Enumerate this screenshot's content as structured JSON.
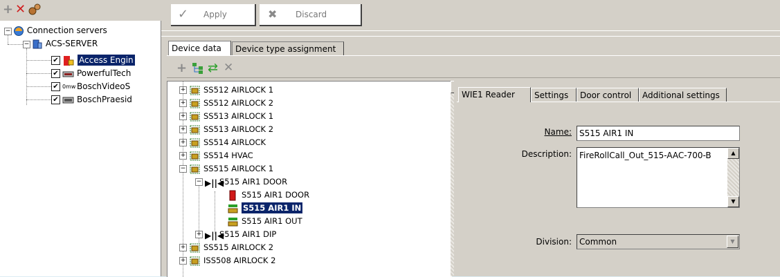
{
  "left_toolbar": {
    "icons": [
      "add-icon",
      "delete-icon",
      "connect-icon"
    ]
  },
  "left_tree": {
    "root_label": "Connection servers",
    "server_label": "ACS-SERVER",
    "items": [
      {
        "label": "Access Engin",
        "selected": true,
        "icon": "access-engine-icon"
      },
      {
        "label": "PowerfulTech",
        "selected": false,
        "icon": "device-icon"
      },
      {
        "label": "BoschVideoS",
        "selected": false,
        "icon": "video-icon"
      },
      {
        "label": "BoschPraesid",
        "selected": false,
        "icon": "device-icon"
      }
    ]
  },
  "toolbar": {
    "apply_label": "Apply",
    "discard_label": "Discard"
  },
  "tabs": {
    "device_data": "Device data",
    "device_type_assignment": "Device type assignment"
  },
  "device_toolbar": {
    "icons": [
      "add-icon",
      "tree-icon",
      "refresh-icon",
      "delete-icon"
    ]
  },
  "device_tree": {
    "rows": [
      {
        "label": "SS512 AIRLOCK 1"
      },
      {
        "label": "SS512 AIRLOCK 2"
      },
      {
        "label": "SS513 AIRLOCK 1"
      },
      {
        "label": "SS513 AIRLOCK 2"
      },
      {
        "label": "SS514 AIRLOCK"
      },
      {
        "label": "SS514 HVAC"
      },
      {
        "label": "SS515 AIRLOCK 1"
      },
      {
        "label": "S515 AIR1 DOOR"
      },
      {
        "label": "S515 AIR1 DOOR"
      },
      {
        "label": "S515 AIR1 IN"
      },
      {
        "label": "S515 AIR1 OUT"
      },
      {
        "label": "S515 AIR1 DIP"
      },
      {
        "label": "SS515 AIRLOCK 2"
      },
      {
        "label": "ISS508 AIRLOCK 2"
      }
    ]
  },
  "detail_tabs": {
    "wie1_reader": "WIE1 Reader",
    "settings": "Settings",
    "door_control": "Door control",
    "additional_settings": "Additional settings"
  },
  "form": {
    "name_label": "Name:",
    "name_value": "S515 AIR1 IN",
    "description_label": "Description:",
    "description_value": "FireRollCall_Out_515-AAC-700-B",
    "division_label": "Division:",
    "division_value": "Common"
  },
  "colors": {
    "selection": "#0a246a",
    "window_bg": "#d4d0c8",
    "desktop_bg": "#dcecf3"
  }
}
